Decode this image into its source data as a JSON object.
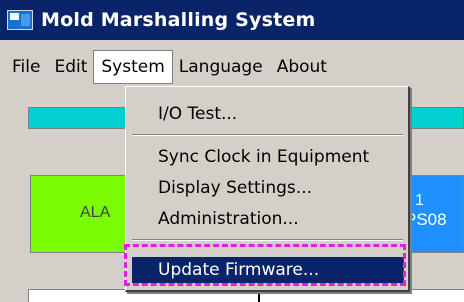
{
  "window": {
    "title": "Mold Marshalling System"
  },
  "menubar": {
    "items": [
      "File",
      "Edit",
      "System",
      "Language",
      "About"
    ]
  },
  "background": {
    "alarm_label": "ALA",
    "right_panel_number": "1",
    "right_panel_code": "PS08"
  },
  "system_menu": {
    "items": [
      "I/O Test...",
      "Sync Clock in Equipment",
      "Display Settings...",
      "Administration...",
      "Update Firmware..."
    ]
  },
  "colors": {
    "titlebar": "#0a246a",
    "menu_highlight": "#0a246a",
    "annotation_frame": "#e020e0",
    "status_bar": "#00d0d0",
    "alarm_panel": "#7cfc00",
    "right_panel": "#1e90ff"
  },
  "icons": {
    "app": "app-window-icon"
  }
}
